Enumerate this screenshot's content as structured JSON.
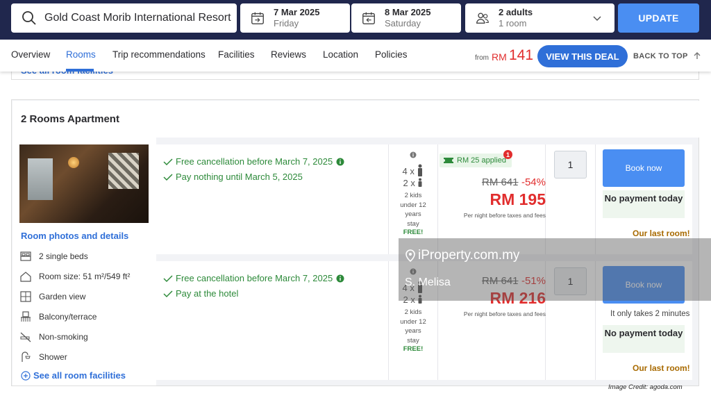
{
  "search": {
    "hotel": "Gold Coast Morib International Resort",
    "checkin_date": "7 Mar 2025",
    "checkin_day": "Friday",
    "checkout_date": "8 Mar 2025",
    "checkout_day": "Saturday",
    "guests": "2 adults",
    "rooms": "1 room",
    "update_label": "UPDATE"
  },
  "nav": {
    "tabs": [
      "Overview",
      "Rooms",
      "Trip recommendations",
      "Facilities",
      "Reviews",
      "Location",
      "Policies"
    ],
    "active_tab": "Rooms",
    "from_label": "from",
    "from_currency": "RM",
    "from_price": "141",
    "deal_label": "VIEW THIS DEAL",
    "back_to_top": "BACK TO TOP"
  },
  "prev_card_link": "See all room facilities",
  "room": {
    "title": "2 Rooms Apartment",
    "photos_link": "Room photos and details",
    "facilities": [
      "2 single beds",
      "Room size: 51 m²/549 ft²",
      "Garden view",
      "Balcony/terrace",
      "Non-smoking",
      "Shower"
    ],
    "see_all": "See all room facilities"
  },
  "offers": [
    {
      "conditions": [
        "Free cancellation before March 7, 2025",
        "Pay nothing until March 5, 2025"
      ],
      "adults": "4 x",
      "children": "2 x",
      "kids_note": [
        "2 kids",
        "under 12",
        "years",
        "stay"
      ],
      "kids_free": "FREE!",
      "applied": "RM 25 applied",
      "applied_badge": "1",
      "original": "RM 641",
      "discount": "-54%",
      "price": "RM 195",
      "per_night": "Per night before taxes and fees",
      "qty": "1",
      "book": "Book now",
      "no_payment": "No payment today",
      "takes": "",
      "last_room": "Our last room!"
    },
    {
      "conditions": [
        "Free cancellation before March 7, 2025",
        "Pay at the hotel"
      ],
      "adults": "4 x",
      "children": "2 x",
      "kids_note": [
        "2 kids",
        "under 12",
        "years",
        "stay"
      ],
      "kids_free": "FREE!",
      "original": "RM 641",
      "discount": "-51%",
      "price": "RM 216",
      "per_night": "Per night before taxes and fees",
      "qty": "1",
      "book": "Book now",
      "no_payment": "No payment today",
      "takes": "It only takes 2 minutes",
      "last_room": "Our last room!"
    }
  ],
  "watermark": {
    "brand": "iProperty.com.my",
    "name": "S. Melisa"
  },
  "credit": "Image Credit: agoda.com",
  "colors": {
    "topbar": "#20274d",
    "accent": "#2f6fd8",
    "price_red": "#e12d2d",
    "success": "#2d8a3a"
  }
}
